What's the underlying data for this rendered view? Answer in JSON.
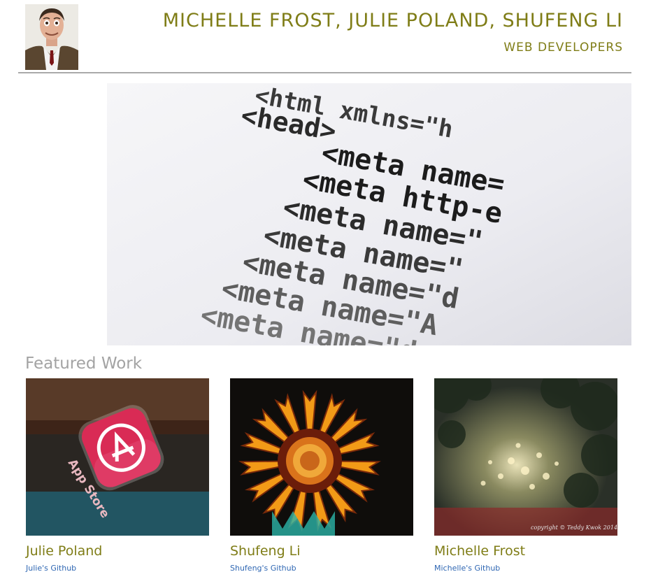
{
  "header": {
    "title": "MICHELLE FROST, JULIE POLAND, SHUFENG LI",
    "subtitle": "WEB DEVELOPERS"
  },
  "hero": {
    "code_lines": [
      "<html xmlns=\"h",
      "<head>",
      "<meta name=",
      "<meta http-e",
      "<meta name=\"",
      "<meta name=\"",
      "<meta name=\"d",
      "<meta name=\"A",
      "<meta name=\"d"
    ]
  },
  "featured": {
    "heading": "Featured Work",
    "cards": [
      {
        "name": "Julie Poland",
        "link": "Julie's Github",
        "badge": "App Store"
      },
      {
        "name": "Shufeng Li",
        "link": "Shufeng's Github"
      },
      {
        "name": "Michelle Frost",
        "link": "Michelle's Github",
        "watermark": "copyright © Teddy Kwok 2014"
      }
    ]
  },
  "colors": {
    "accent": "#7f7d17",
    "link": "#2f67b3",
    "muted": "#a3a3a3",
    "divider": "#a9a9a9"
  }
}
